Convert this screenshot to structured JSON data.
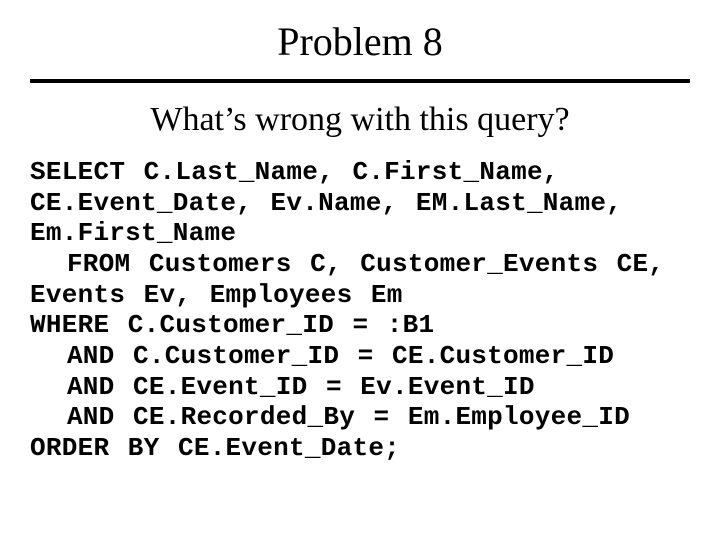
{
  "title": "Problem 8",
  "subtitle": "What’s wrong with this query?",
  "sql": "SELECT C.Last_Name, C.First_Name, CE.Event_Date, Ev.Name, EM.Last_Name, Em.First_Name\n  FROM Customers C, Customer_Events CE, Events Ev, Employees Em\nWHERE C.Customer_ID = :B1\n  AND C.Customer_ID = CE.Customer_ID\n  AND CE.Event_ID = Ev.Event_ID\n  AND CE.Recorded_By = Em.Employee_ID\nORDER BY CE.Event_Date;"
}
